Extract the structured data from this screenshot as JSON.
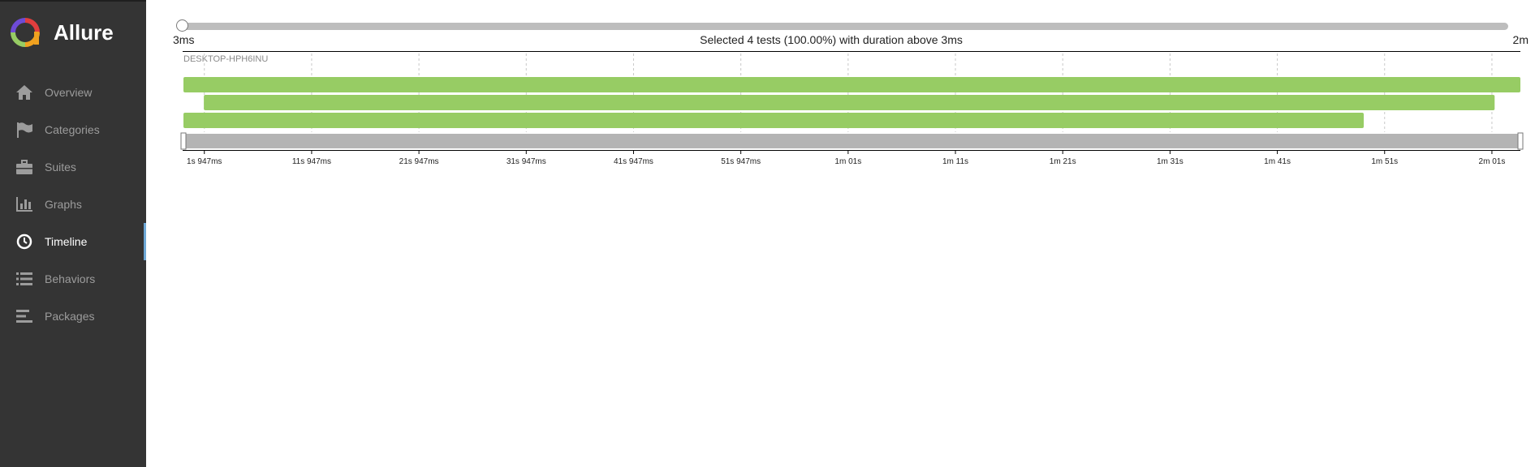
{
  "brand": {
    "name": "Allure",
    "logo_icon": "allure-logo-icon"
  },
  "nav": {
    "items": [
      {
        "key": "overview",
        "label": "Overview",
        "icon": "home-icon",
        "active": false
      },
      {
        "key": "categories",
        "label": "Categories",
        "icon": "flag-icon",
        "active": false
      },
      {
        "key": "suites",
        "label": "Suites",
        "icon": "briefcase-icon",
        "active": false
      },
      {
        "key": "graphs",
        "label": "Graphs",
        "icon": "bar-chart-icon",
        "active": false
      },
      {
        "key": "timeline",
        "label": "Timeline",
        "icon": "clock-icon",
        "active": true
      },
      {
        "key": "behaviors",
        "label": "Behaviors",
        "icon": "list-icon",
        "active": false
      },
      {
        "key": "packages",
        "label": "Packages",
        "icon": "align-left-icon",
        "active": false
      }
    ]
  },
  "slider": {
    "min_label": "3ms",
    "max_label": "2m",
    "selection_text": "Selected 4 tests (100.00%) with duration above 3ms",
    "handle_fraction": 0
  },
  "timeline": {
    "host": "DESKTOP-HPH6INU",
    "axis_start_seconds": 0,
    "axis_end_seconds": 124.6,
    "ticks": [
      {
        "seconds": 1.947,
        "label": "1s 947ms"
      },
      {
        "seconds": 11.947,
        "label": "11s 947ms"
      },
      {
        "seconds": 21.947,
        "label": "21s 947ms"
      },
      {
        "seconds": 31.947,
        "label": "31s 947ms"
      },
      {
        "seconds": 41.947,
        "label": "41s 947ms"
      },
      {
        "seconds": 51.947,
        "label": "51s 947ms"
      },
      {
        "seconds": 61.947,
        "label": "1m 01s"
      },
      {
        "seconds": 71.947,
        "label": "1m 11s"
      },
      {
        "seconds": 81.947,
        "label": "1m 21s"
      },
      {
        "seconds": 91.947,
        "label": "1m 31s"
      },
      {
        "seconds": 101.947,
        "label": "1m 41s"
      },
      {
        "seconds": 111.947,
        "label": "1m 51s"
      },
      {
        "seconds": 121.947,
        "label": "2m 01s"
      }
    ],
    "bars": [
      {
        "start_seconds": 0.0,
        "end_seconds": 124.6,
        "status": "passed"
      },
      {
        "start_seconds": 1.9,
        "end_seconds": 122.2,
        "status": "passed"
      },
      {
        "start_seconds": 0.0,
        "end_seconds": 110.0,
        "status": "passed"
      }
    ],
    "brush": {
      "start_fraction": 0,
      "end_fraction": 1
    }
  },
  "colors": {
    "passed": "#97cc64",
    "brush": "#b4b4b4",
    "grid": "#c8c8c8",
    "axis": "#000000"
  }
}
